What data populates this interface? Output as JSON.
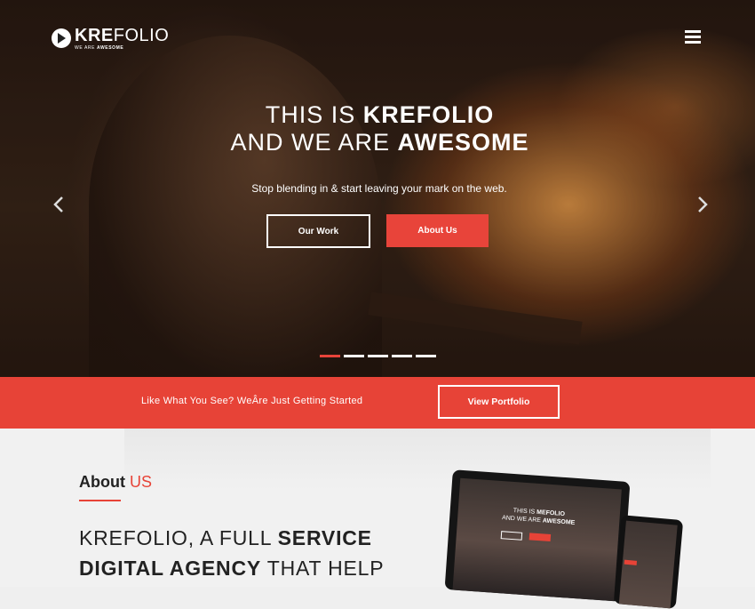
{
  "brand": {
    "name_bold": "KRE",
    "name_regular": "FOLIO",
    "tagline_prefix": "WE ARE ",
    "tagline_bold": "AWESOME"
  },
  "hero": {
    "title_line1_regular": "THIS IS ",
    "title_line1_bold": "KREFOLIO",
    "title_line2_regular": "AND WE ARE ",
    "title_line2_bold": "AWESOME",
    "subtitle": "Stop blending in & start leaving your mark on the web.",
    "buttons": {
      "our_work": "Our Work",
      "about_us": "About Us"
    },
    "slides": [
      {
        "active": true
      },
      {
        "active": false
      },
      {
        "active": false
      },
      {
        "active": false
      },
      {
        "active": false
      }
    ]
  },
  "cta": {
    "text": "Like What You See? WeÂre Just Getting Started",
    "button": "View Portfolio"
  },
  "about": {
    "title_bold": "About",
    "title_accent": "US",
    "headline_line1_regular": "KREFOLIO, A FULL ",
    "headline_line1_bold": "SERVICE",
    "headline_line2_bold": "DIGITAL AGENCY",
    "headline_line2_regular": " THAT HELP"
  },
  "device_preview": {
    "line1_regular": "THIS IS ",
    "line1_bold": "MEFOLIO",
    "line2_regular": "AND WE ARE ",
    "line2_bold": "AWESOME"
  },
  "colors": {
    "accent": "#e74337",
    "hero_overlay": "#2a1a12",
    "about_bg": "#f1f1f1"
  },
  "icons": {
    "menu": "hamburger-menu-icon",
    "prev": "chevron-left-icon",
    "next": "chevron-right-icon",
    "logo": "play-logo-icon"
  }
}
